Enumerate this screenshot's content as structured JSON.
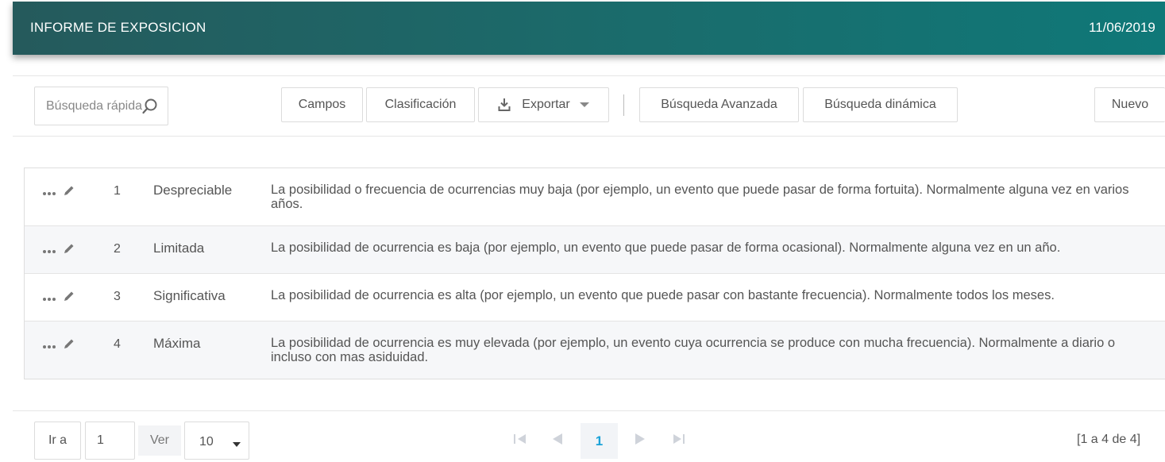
{
  "header": {
    "title": "INFORME DE EXPOSICION",
    "date": "11/06/2019"
  },
  "toolbar": {
    "search_placeholder": "Búsqueda rápida",
    "campos": "Campos",
    "clasificacion": "Clasificación",
    "exportar": "Exportar",
    "busqueda_avanzada": "Búsqueda Avanzada",
    "busqueda_dinamica": "Búsqueda dinámica",
    "nuevo": "Nuevo"
  },
  "rows": [
    {
      "num": "1",
      "name": "Despreciable",
      "desc": "La posibilidad o frecuencia de ocurrencias muy baja (por ejemplo, un evento que puede pasar de forma fortuita). Normalmente alguna vez en varios años."
    },
    {
      "num": "2",
      "name": "Limitada",
      "desc": "La posibilidad de ocurrencia es baja (por ejemplo, un evento que puede pasar de forma ocasional). Normalmente alguna vez en un año."
    },
    {
      "num": "3",
      "name": "Significativa",
      "desc": "La posibilidad de ocurrencia es alta (por ejemplo, un evento que puede pasar con bastante frecuencia). Normalmente todos los meses."
    },
    {
      "num": "4",
      "name": "Máxima",
      "desc": "La posibilidad de ocurrencia es muy elevada (por ejemplo, un evento cuya ocurrencia se produce con mucha frecuencia). Normalmente a diario o incluso con mas asiduidad."
    }
  ],
  "footer": {
    "ir_a": "Ir a",
    "page_input": "1",
    "ver": "Ver",
    "page_size": "10",
    "current_page": "1",
    "summary": "[1 a 4 de 4]"
  }
}
